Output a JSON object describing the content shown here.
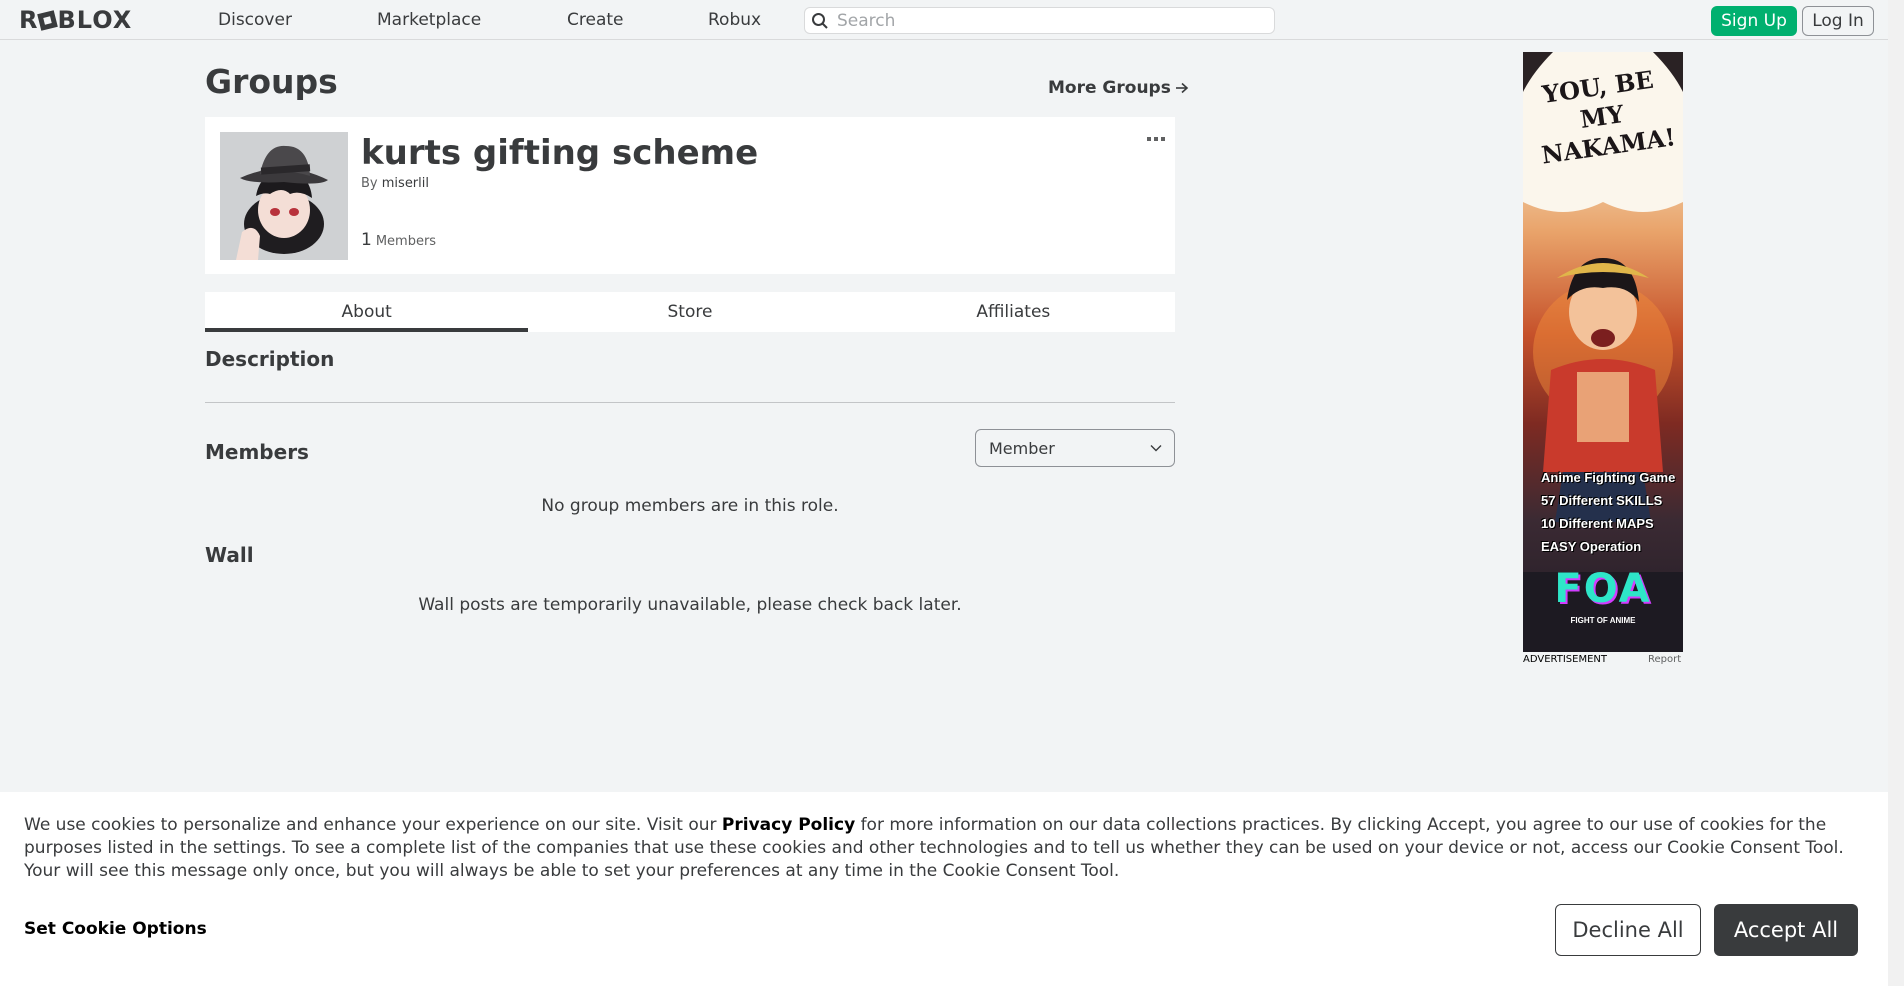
{
  "nav": {
    "logo": "ROBLOX",
    "links": [
      "Discover",
      "Marketplace",
      "Create",
      "Robux"
    ],
    "search_placeholder": "Search",
    "signup": "Sign Up",
    "login": "Log In"
  },
  "page": {
    "title": "Groups",
    "more_groups": "More Groups"
  },
  "group": {
    "name": "kurts gifting scheme",
    "by_label": "By",
    "owner": "miserlil",
    "member_count": "1",
    "members_label": "Members"
  },
  "tabs": [
    "About",
    "Store",
    "Affiliates"
  ],
  "about": {
    "description_title": "Description",
    "members_title": "Members",
    "role_selected": "Member",
    "members_empty": "No group members are in this role.",
    "wall_title": "Wall",
    "wall_empty": "Wall posts are temporarily unavailable, please check back later."
  },
  "ad": {
    "headline": "YOU, BE MY NAKAMA!",
    "features": [
      "Anime Fighting Game",
      "57 Different SKILLS",
      "10 Different MAPS",
      "EASY Operation"
    ],
    "brand": "FOA",
    "brand_sub": "FIGHT OF ANIME",
    "footer_label": "ADVERTISEMENT",
    "report": "Report"
  },
  "cookie": {
    "text_before": "We use cookies to personalize and enhance your experience on our site. Visit our ",
    "policy_link": "Privacy Policy",
    "text_after": " for more information on our data collections practices. By clicking Accept, you agree to our use of cookies for the purposes listed in the settings. To see a complete list of the companies that use these cookies and other technologies and to tell us whether they can be used on your device or not, access our Cookie Consent Tool. Your will see this message only once, but you will always be able to set your preferences at any time in the Cookie Consent Tool.",
    "options": "Set Cookie Options",
    "decline": "Decline All",
    "accept": "Accept All"
  },
  "colors": {
    "signup_green": "#00b06f",
    "accept_dark": "#393b3d",
    "page_bg": "#f2f4f5"
  }
}
